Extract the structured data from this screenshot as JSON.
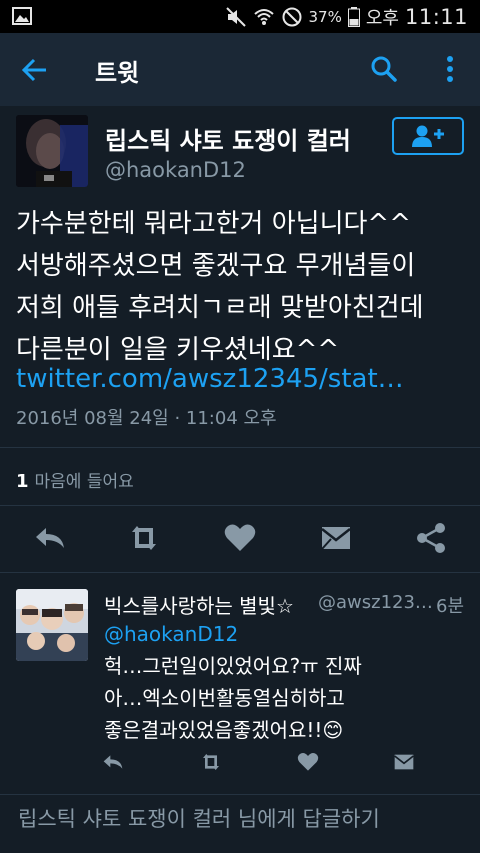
{
  "status_bar": {
    "battery_percent": "37%",
    "ampm": "오후",
    "time": "11:11"
  },
  "app_bar": {
    "title": "트윗"
  },
  "tweet": {
    "author_name": "립스틱 샤토 됴쟁이 컬러",
    "author_handle": "@haokanD12",
    "text": "가수분한테 뭐라고한거 아닙니다^^\n서방해주셨으면 좋겠구요 무개념들이\n저희 애들 후려치ㄱㄹ래 맞받아친건데\n다른분이 일을 키우셨네요^^",
    "link": "twitter.com/awsz12345/stat…",
    "date": "2016년 08월 24일 · 11:04 오후",
    "likes_count": "1",
    "likes_label": "마음에 들어요"
  },
  "reply": {
    "author_name": "빅스를사랑하는 별빛☆",
    "author_handle": "@awsz123…",
    "time": "6분",
    "mention": "@haokanD12",
    "text": "헉…그런일이있었어요?ㅠ 진짜\n아…엑소이번활동열심히하고\n좋은결과있었음좋겠어요!!😊"
  },
  "composer": {
    "placeholder": "립스틱 샤토 됴쟁이 컬러 님에게 답글하기"
  },
  "colors": {
    "background": "#141d26",
    "appbar": "#1b2836",
    "accent": "#1da1f2",
    "secondary_text": "#8899a6",
    "icon": "#8899a6"
  },
  "icons": {
    "gallery": "image-icon",
    "mute": "mute-icon",
    "wifi": "wifi-icon",
    "dnd": "do-not-disturb-icon",
    "battery": "battery-icon",
    "back": "arrow-left-icon",
    "search": "search-icon",
    "more": "more-vertical-icon",
    "follow": "add-user-icon",
    "reply": "reply-icon",
    "retweet": "retweet-icon",
    "like": "heart-icon",
    "dm": "envelope-icon",
    "share": "share-icon"
  }
}
